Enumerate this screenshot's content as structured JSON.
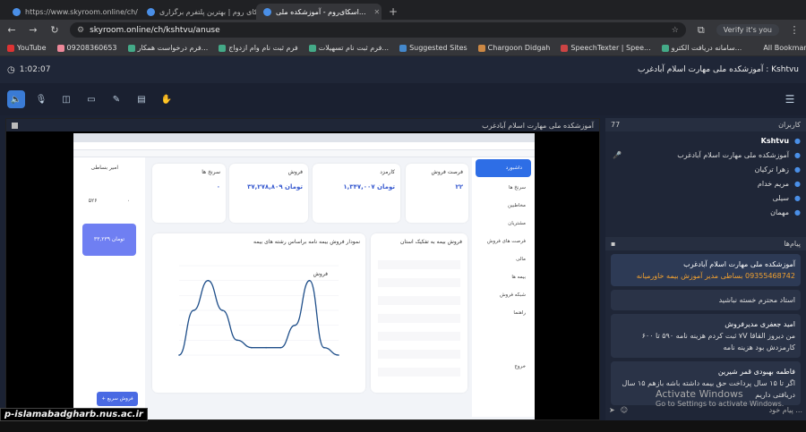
{
  "browser": {
    "tabs": [
      {
        "label": "https://www.skyroom.online/ch/",
        "active": false
      },
      {
        "label": "اسکای روم | بهترین پلتفرم برگزاری",
        "active": false
      },
      {
        "label": "اسکای‌روم - آموزشکده ملی...",
        "active": true
      }
    ],
    "new_tab": "+",
    "url": "skyroom.online/ch/kshtvu/anuse",
    "verify_label": "Verify it's you",
    "bookmarks": [
      "YouTube",
      "09208360653",
      "فرم درخواست همکار...",
      "فرم ثبت نام وام ازدواج",
      "فرم ثبت نام تسهیلات...",
      "Suggested Sites",
      "Chargoon Didgah",
      "SpeechTexter | Spee...",
      "سامانه دریافت الکترو..."
    ],
    "all_bookmarks": "All Bookmarks"
  },
  "app": {
    "timer": "1:02:07",
    "room_title": "آموزشکده ملی مهارت اسلام آبادغرب : Kshtvu",
    "stage_title": "آموزشکده ملی مهارت اسلام آبادغرب",
    "toolbar": [
      "speaker-icon",
      "mic-off-icon",
      "camera-off-icon",
      "screen-icon",
      "pen-icon",
      "board-icon",
      "hand-icon"
    ]
  },
  "users_panel": {
    "title": "کاربران",
    "count": "77",
    "users": [
      "Kshtvu",
      "آموزشکده ملی مهارت اسلام آبادغرب",
      "زهرا ترکیان",
      "مریم خدام",
      "سیلی",
      "مهمان"
    ]
  },
  "messages_panel": {
    "title": "پیام‌ها",
    "messages": [
      {
        "sender": "آموزشکده ملی مهارت اسلام آبادغرب",
        "text": "09355468742 بساطی مدیر آموزش بیمه خاورمیانه"
      },
      {
        "sender": "",
        "text": "استاد محترم خسته نباشید"
      },
      {
        "sender": "امید جعفری مدیرفروش",
        "text": "من دیروز القاقا ۷V ثبت کردم هزینه نامه ۵۹۰ تا ۶۰۰ کارمزدش بود هزینه نامه"
      },
      {
        "sender": "فاطمه بهبودی قمر شیرین",
        "text": "اگر تا ۱۵ سال پرداخت حق بیمه داشته باشه بازهم ۱۵ سال دریافتی داریم"
      }
    ],
    "input_placeholder": "پیام خود ...",
    "watermark_title": "Activate Windows",
    "watermark_sub": "Go to Settings to activate Windows."
  },
  "shared_screen": {
    "cards": [
      {
        "title": "فرصت فروش",
        "value": "۲۲"
      },
      {
        "title": "کارمزد",
        "value": "۱,۳۴۷,۰۰۷ تومان"
      },
      {
        "title": "فروش",
        "value": "۳۷,۲۷۸,۸۰۹ تومان"
      },
      {
        "title": "سرنخ ها",
        "value": "۰"
      }
    ],
    "menu": [
      "داشبورد",
      "سرنخ ها",
      "مخاطبین",
      "مشتریان",
      "فرصت های فروش",
      "مالی",
      "بیمه ها",
      "شبکه فروش",
      "راهنما",
      "خروج"
    ],
    "chart_title": "نمودار فروش بیمه نامه براساس رشته های بیمه",
    "chart2_title": "فروش بیمه به تفکیک استان",
    "legend": "فروش",
    "left_title": "امیر بساطی",
    "left_values": [
      "۵۲۶",
      "۰",
      "۳۳,۲۳۹ تومان"
    ],
    "sell_button": "+ فروش سریع"
  },
  "brand": "p-islamabadgharb.nus.ac.ir",
  "chart_data": {
    "type": "line",
    "title": "نمودار فروش بیمه نامه براساس رشته های بیمه",
    "series": [
      {
        "name": "فروش",
        "values": [
          0,
          3,
          5,
          3,
          1,
          0.5,
          0.5,
          0.5,
          2,
          5,
          0.5,
          0
        ]
      }
    ],
    "ylim": [
      0,
      6
    ]
  }
}
